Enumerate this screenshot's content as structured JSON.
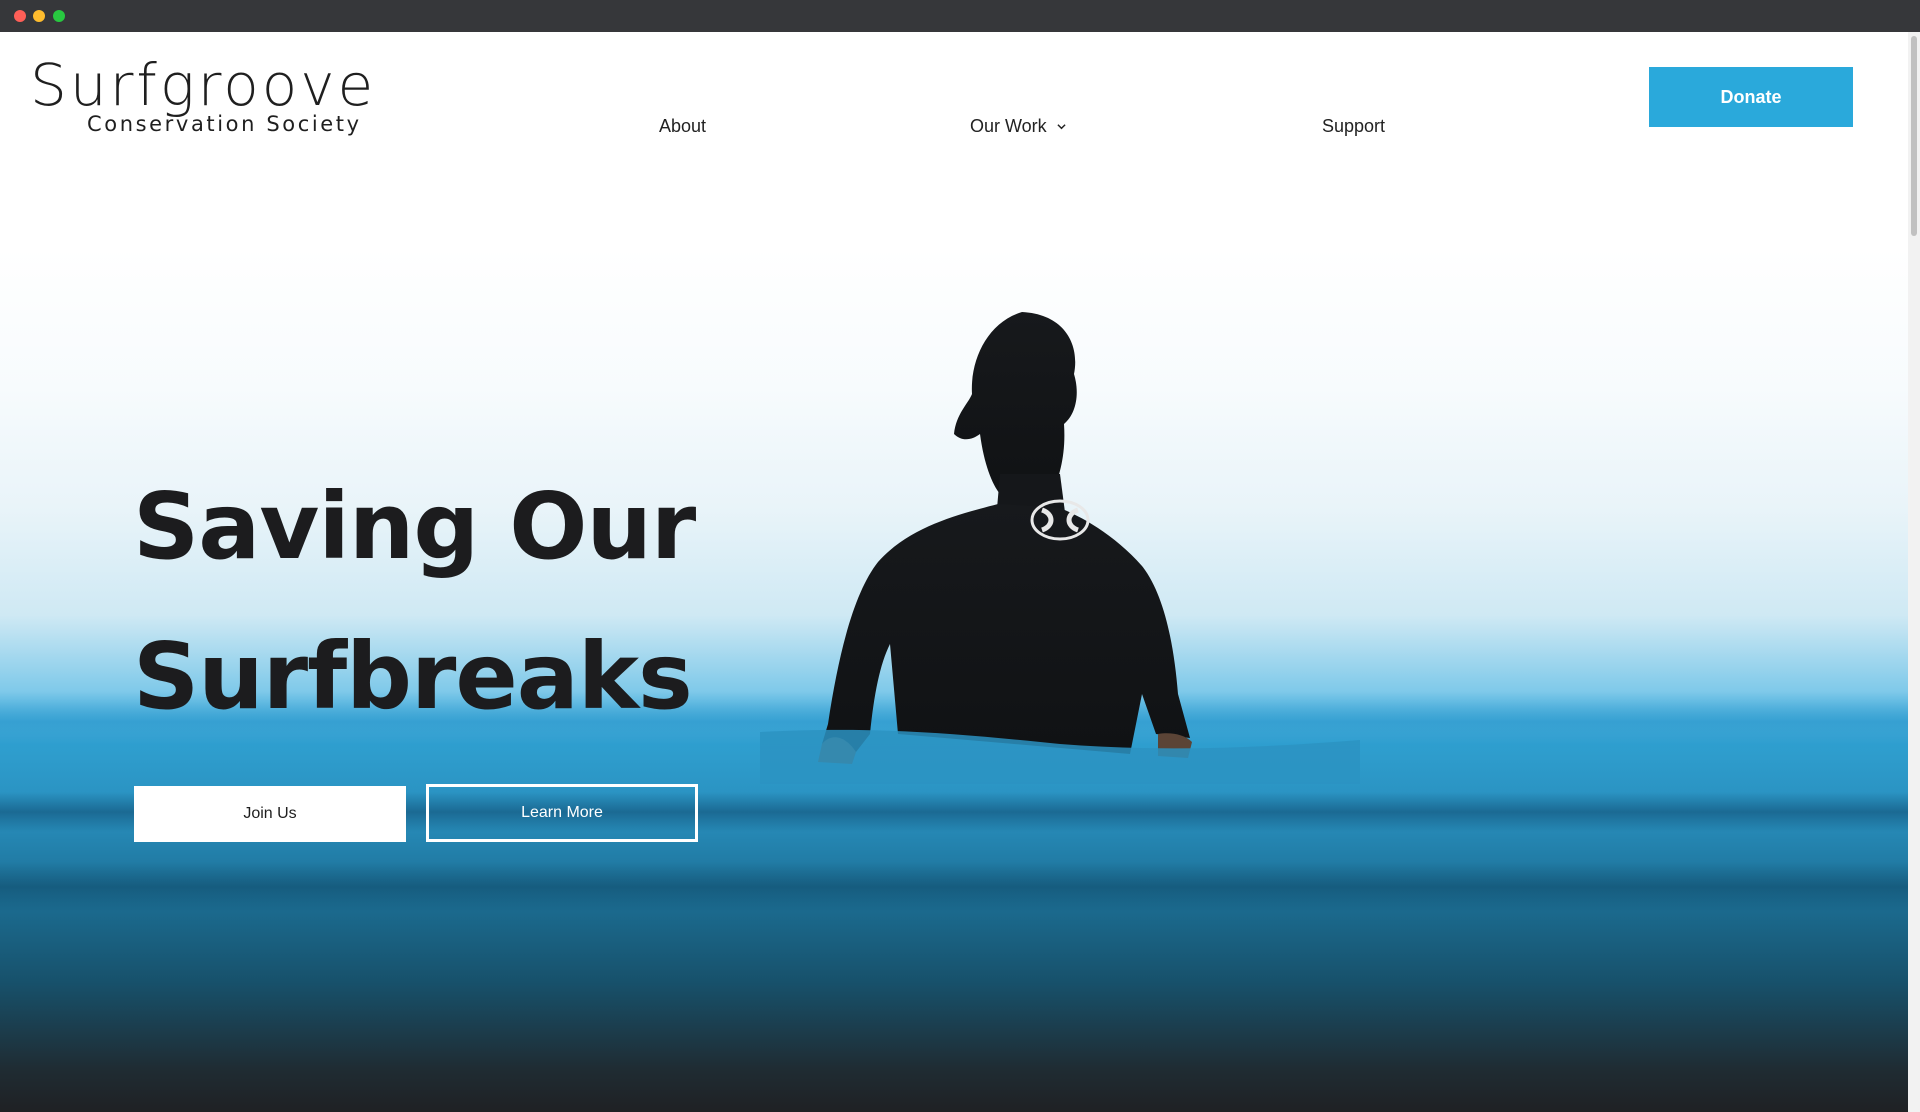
{
  "brand": {
    "name": "Surfgroove",
    "tagline": "Conservation Society"
  },
  "nav": {
    "items": [
      {
        "label": "About"
      },
      {
        "label": "Our Work",
        "has_dropdown": true
      },
      {
        "label": "Support"
      }
    ],
    "donate_label": "Donate"
  },
  "hero": {
    "title_line1": "Saving Our",
    "title_line2": "Surfbreaks",
    "primary_button": "Join Us",
    "secondary_button": "Learn More"
  },
  "icons": {
    "dropdown": "chevron-down-icon",
    "wetsuit_logo": "hurley-logo-icon"
  },
  "colors": {
    "accent": "#2aa9db",
    "text_dark": "#1c1c1e",
    "water_blue": "#2990bf"
  }
}
